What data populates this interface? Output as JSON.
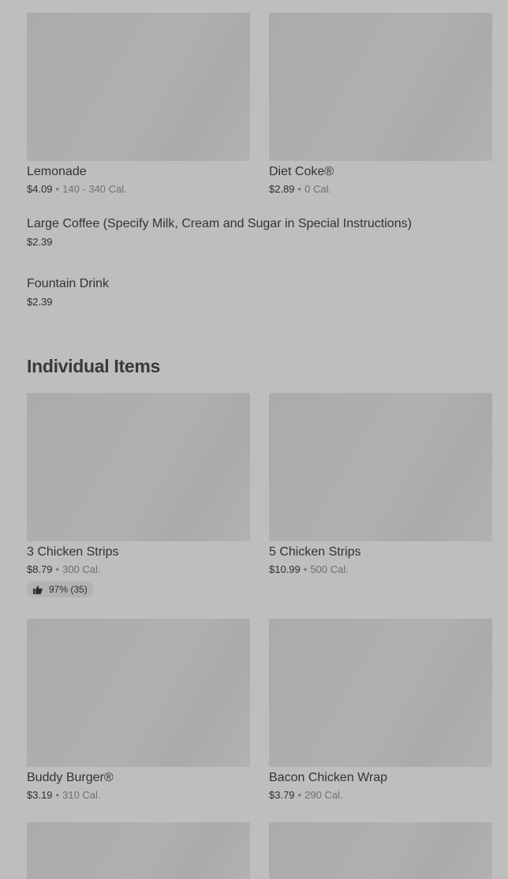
{
  "drinks": {
    "cards": [
      {
        "name": "Lemonade",
        "price": "$4.09",
        "calories": "140 - 340 Cal."
      },
      {
        "name": "Diet Coke®",
        "price": "$2.89",
        "calories": "0 Cal."
      }
    ],
    "rows": [
      {
        "name": "Large Coffee (Specify Milk, Cream and Sugar in Special Instructions)",
        "price": "$2.39"
      },
      {
        "name": "Fountain Drink",
        "price": "$2.39"
      }
    ]
  },
  "individual_items": {
    "title": "Individual Items",
    "cards": [
      {
        "name": "3 Chicken Strips",
        "price": "$8.79",
        "calories": "300 Cal.",
        "rating": "97% (35)"
      },
      {
        "name": "5 Chicken Strips",
        "price": "$10.99",
        "calories": "500 Cal."
      },
      {
        "name": "Buddy Burger®",
        "price": "$3.19",
        "calories": "310 Cal."
      },
      {
        "name": "Bacon Chicken Wrap",
        "price": "$3.79",
        "calories": "290 Cal."
      }
    ]
  },
  "icons": {
    "rating": "thumbs-up-icon"
  },
  "colors": {
    "background": "#bebebe",
    "placeholder": "#ababab"
  }
}
